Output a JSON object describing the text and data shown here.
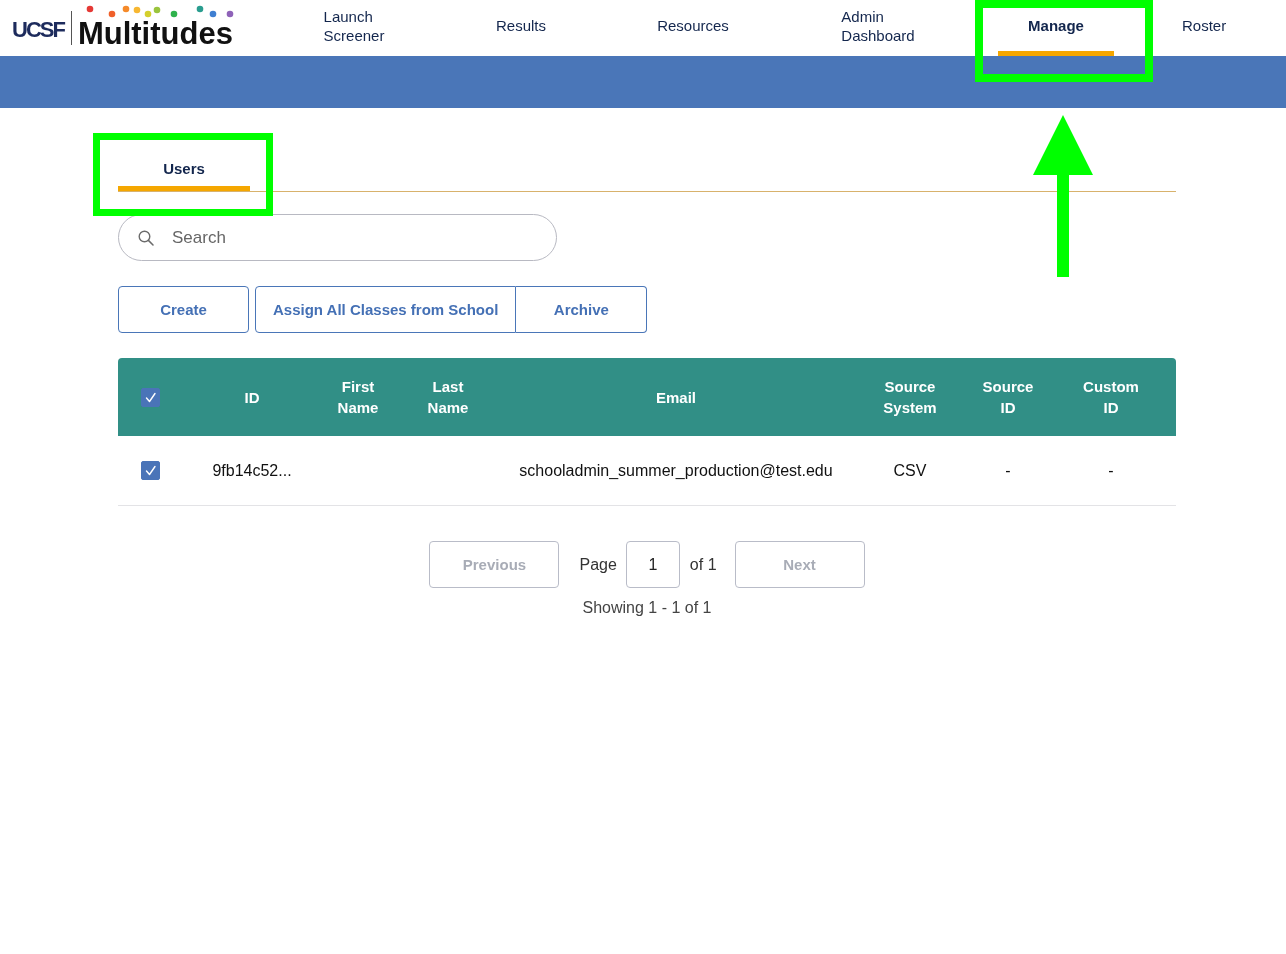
{
  "logo": {
    "org": "UCSF",
    "product": "Multitudes"
  },
  "nav": {
    "items": [
      {
        "label": "Launch Screener",
        "selected": false,
        "highlighted": false,
        "arrow": false
      },
      {
        "label": "Results",
        "selected": false,
        "highlighted": false,
        "arrow": false
      },
      {
        "label": "Resources",
        "selected": false,
        "highlighted": false,
        "arrow": false
      },
      {
        "label": "Admin Dashboard",
        "selected": false,
        "highlighted": false,
        "arrow": false
      },
      {
        "label": "Manage",
        "selected": true,
        "highlighted": true,
        "arrow": true
      },
      {
        "label": "Roster",
        "selected": false,
        "highlighted": false,
        "arrow": false
      }
    ]
  },
  "tabs": [
    {
      "label": "Users",
      "selected": true,
      "highlighted": true
    }
  ],
  "search": {
    "placeholder": "Search"
  },
  "action_groups": [
    [
      "Create"
    ],
    [
      "Assign All Classes from School",
      "Archive"
    ]
  ],
  "table": {
    "all_selected": true,
    "columns": [
      "ID",
      "First Name",
      "Last Name",
      "Email",
      "Source System",
      "Source ID",
      "Custom ID"
    ],
    "rows": [
      {
        "selected": true,
        "cells": [
          "9fb14c52...",
          null,
          null,
          "schooladmin_summer_production@test.edu",
          "CSV",
          "-",
          "-"
        ]
      }
    ]
  },
  "pagination": {
    "previous": {
      "label": "Previous",
      "disabled": true
    },
    "page_label": "Page",
    "page": "1",
    "total_label": "of 1",
    "next": {
      "label": "Next",
      "disabled": true
    },
    "summary": "Showing 1 - 1 of 1"
  }
}
